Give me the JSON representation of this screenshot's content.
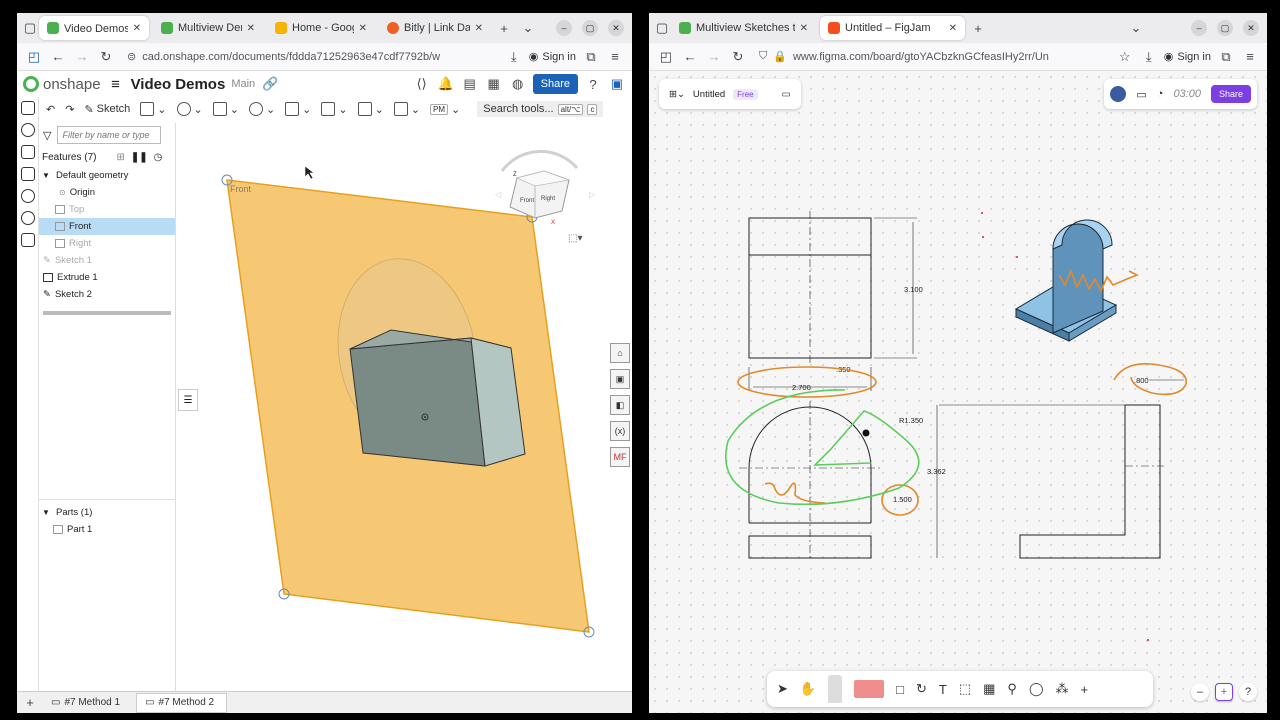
{
  "left_window": {
    "tabs": [
      {
        "label": "Video Demos | ∧",
        "icon": "onshape-favicon",
        "color": "#4caf50"
      },
      {
        "label": "Multiview Demo",
        "icon": "onshape-favicon",
        "color": "#4caf50"
      },
      {
        "label": "Home - Google",
        "icon": "google-drive-favicon",
        "color": "#f4b400"
      },
      {
        "label": "Bitly | Link Dash",
        "icon": "bitly-favicon",
        "color": "#ee6123"
      }
    ],
    "url": "cad.onshape.com/documents/fddda71252963e47cdf7792b/w",
    "sign_in": "Sign in",
    "app_name": "onshape",
    "doc_title": "Video Demos",
    "branch": "Main",
    "share": "Share",
    "toolbar": {
      "sketch": "Sketch",
      "units": "PM",
      "search_tools": "Search tools...",
      "search_shortcut_1": "alt/⌥",
      "search_shortcut_2": "c"
    },
    "filter_placeholder": "Filter by name or type",
    "features_header": "Features (7)",
    "features": [
      {
        "label": "Default geometry",
        "state": "group"
      },
      {
        "label": "Origin",
        "state": "child"
      },
      {
        "label": "Top",
        "state": "dim"
      },
      {
        "label": "Front",
        "state": "selected"
      },
      {
        "label": "Right",
        "state": "dim"
      },
      {
        "label": "Sketch 1",
        "state": "dim"
      },
      {
        "label": "Extrude 1",
        "state": "normal"
      },
      {
        "label": "Sketch 2",
        "state": "normal"
      }
    ],
    "parts_header": "Parts (1)",
    "parts": [
      "Part 1"
    ],
    "plane_label": "Front",
    "viewcube": {
      "front": "Front",
      "right": "Right",
      "axis_z": "Z",
      "axis_x": "X"
    },
    "right_rail": [
      "⌂",
      "▣",
      "◧",
      "(x)",
      "MF"
    ],
    "bottom_tabs": [
      {
        "label": "#7 Method 1",
        "active": false
      },
      {
        "label": "#7 Method 2",
        "active": true
      }
    ],
    "colors": {
      "plane": "#f7c873",
      "plane_edge": "#e6a020",
      "body": "#7a8a85",
      "accent": "#1c63b7"
    }
  },
  "right_window": {
    "tabs": [
      {
        "label": "Multiview Sketches to Pr",
        "icon": "onshape-favicon",
        "color": "#4caf50"
      },
      {
        "label": "Untitled – FigJam",
        "icon": "figma-favicon",
        "color": "#f24e1e"
      }
    ],
    "url": "www.figma.com/board/gtoYACbzknGCfeasIHy2rr/Un",
    "sign_in": "Sign in",
    "file_name": "Untitled",
    "plan_badge": "Free",
    "timer": "03:00",
    "share": "Share",
    "dimensions": [
      "3.100",
      ".350",
      "2.700",
      "R1.350",
      "3.362",
      "1.500",
      ".800"
    ],
    "colors": {
      "accent": "#7b3fe4",
      "pen_orange": "#e08a2a",
      "pen_green": "#5ecb5e",
      "iso_blue": "#8fc3e6"
    }
  }
}
